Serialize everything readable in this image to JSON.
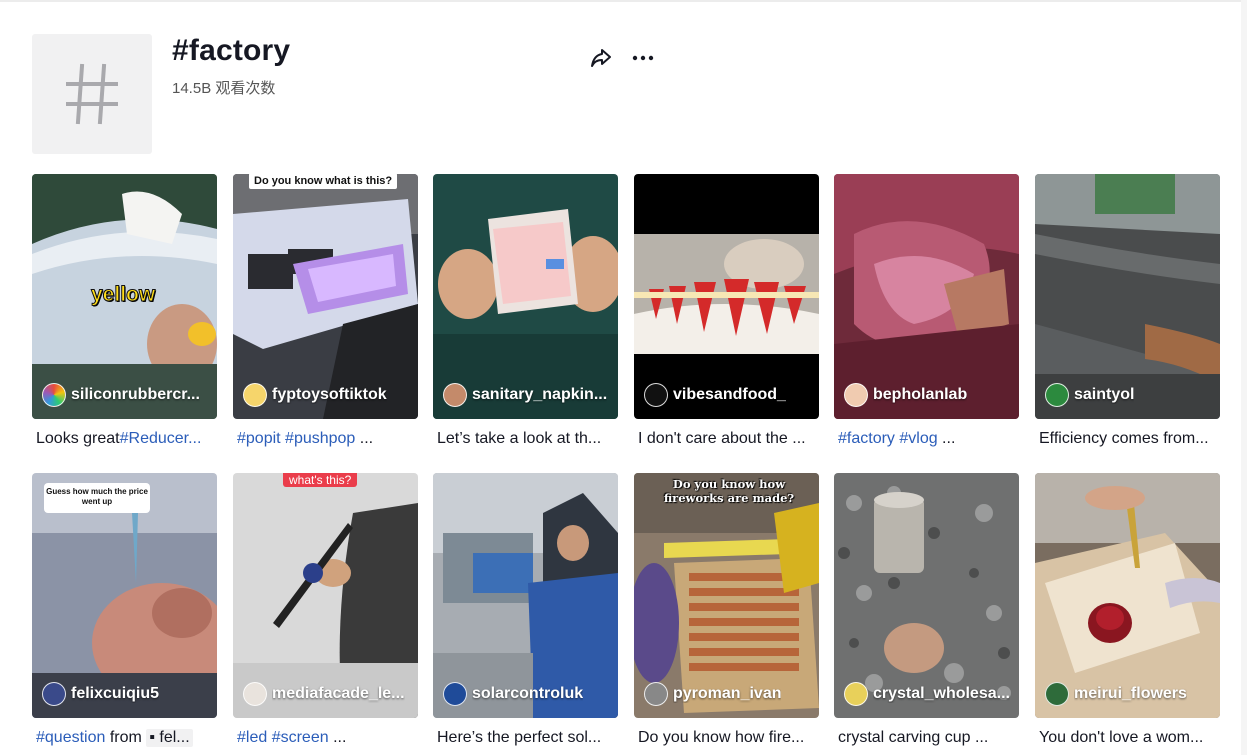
{
  "header": {
    "title": "#factory",
    "views": "14.5B 观看次数",
    "share_icon": "share-icon",
    "more_icon": "more-icon"
  },
  "videos": [
    {
      "author": "siliconrubbercr...",
      "caption_tags": "",
      "caption_text": "Looks great",
      "caption_tags_after": "#Reducer...",
      "overlay": "yellow"
    },
    {
      "author": "fyptoysoftiktok",
      "caption_tags": "#popit #pushpop",
      "caption_text": " ...",
      "overlay": "Do you know what is this?"
    },
    {
      "author": "sanitary_napkin...",
      "caption_text": "Let’s take a look at th..."
    },
    {
      "author": "vibesandfood_",
      "caption_text": "I don't care about the ..."
    },
    {
      "author": "bepholanlab",
      "caption_tags": "#factory #vlog",
      "caption_text": " ..."
    },
    {
      "author": "saintyol",
      "caption_text": "Efficiency comes from..."
    },
    {
      "author": "felixcuiqiu5",
      "caption_tags": "#question",
      "caption_text": " from ",
      "mention": "fel...",
      "overlay": "Guess how much the price went up"
    },
    {
      "author": "mediafacade_le...",
      "caption_tags": "#led #screen",
      "caption_text": " ...",
      "overlay": "what's this?"
    },
    {
      "author": "solarcontroluk",
      "caption_text": "Here’s the perfect sol..."
    },
    {
      "author": "pyroman_ivan",
      "caption_text": "Do you know how fire...",
      "overlay": "Do you know how fireworks are made?"
    },
    {
      "author": "crystal_wholesa...",
      "caption_text": "crystal carving cup ..."
    },
    {
      "author": "meirui_flowers",
      "caption_text": "You don't love a wom..."
    }
  ],
  "colors": {
    "hashtag": "#2b5db9",
    "tile_bg": "#f1f1f2"
  }
}
